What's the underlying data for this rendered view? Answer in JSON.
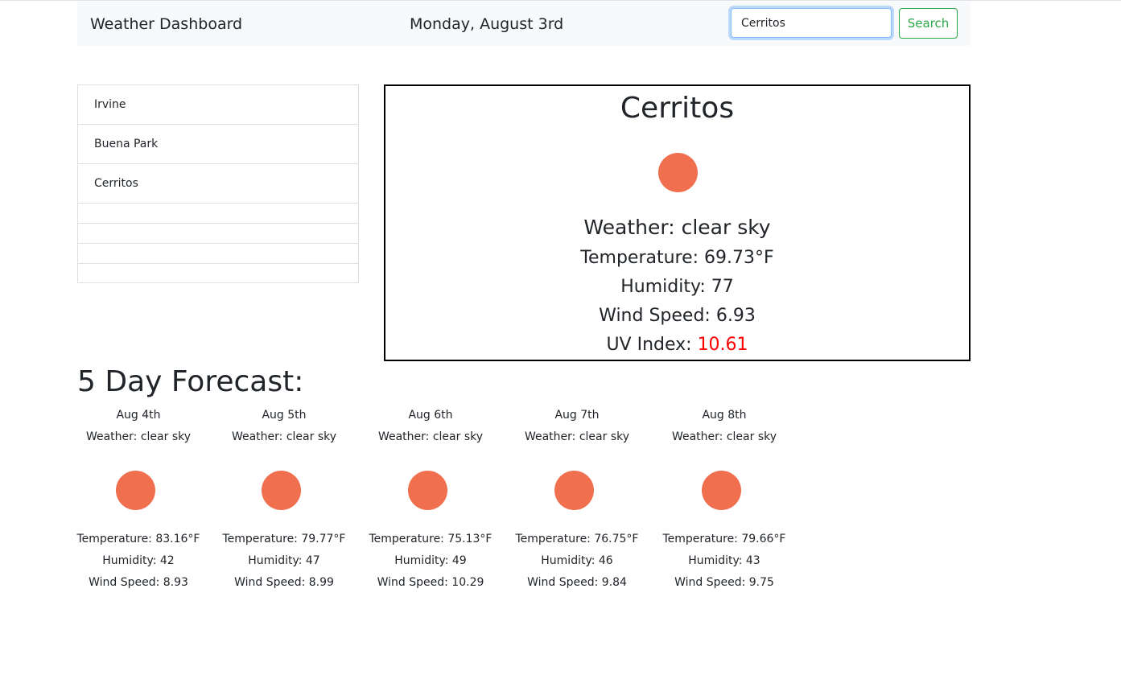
{
  "header": {
    "title": "Weather Dashboard",
    "date": "Monday, August 3rd",
    "search_value": "Cerritos",
    "search_button": "Search"
  },
  "sidebar": {
    "cities": [
      "Irvine",
      "Buena Park",
      "Cerritos"
    ]
  },
  "current": {
    "city": "Cerritos",
    "icon": "sun-icon",
    "weather": "Weather: clear sky",
    "temperature": "Temperature: 69.73°F",
    "humidity": "Humidity: 77",
    "wind": "Wind Speed: 6.93",
    "uv_label": "UV Index:",
    "uv_value": "10.61"
  },
  "forecast": {
    "title": "5 Day Forecast:",
    "days": [
      {
        "date": "Aug 4th",
        "weather": "Weather: clear sky",
        "temperature": "Temperature: 83.16°F",
        "humidity": "Humidity: 42",
        "wind": "Wind Speed: 8.93"
      },
      {
        "date": "Aug 5th",
        "weather": "Weather: clear sky",
        "temperature": "Temperature: 79.77°F",
        "humidity": "Humidity: 47",
        "wind": "Wind Speed: 8.99"
      },
      {
        "date": "Aug 6th",
        "weather": "Weather: clear sky",
        "temperature": "Temperature: 75.13°F",
        "humidity": "Humidity: 49",
        "wind": "Wind Speed: 10.29"
      },
      {
        "date": "Aug 7th",
        "weather": "Weather: clear sky",
        "temperature": "Temperature: 76.75°F",
        "humidity": "Humidity: 46",
        "wind": "Wind Speed: 9.84"
      },
      {
        "date": "Aug 8th",
        "weather": "Weather: clear sky",
        "temperature": "Temperature: 79.66°F",
        "humidity": "Humidity: 43",
        "wind": "Wind Speed: 9.75"
      }
    ]
  },
  "colors": {
    "sun": "#ef6f4f",
    "uv_high": "#ff0000",
    "search_accent": "#28a745"
  }
}
